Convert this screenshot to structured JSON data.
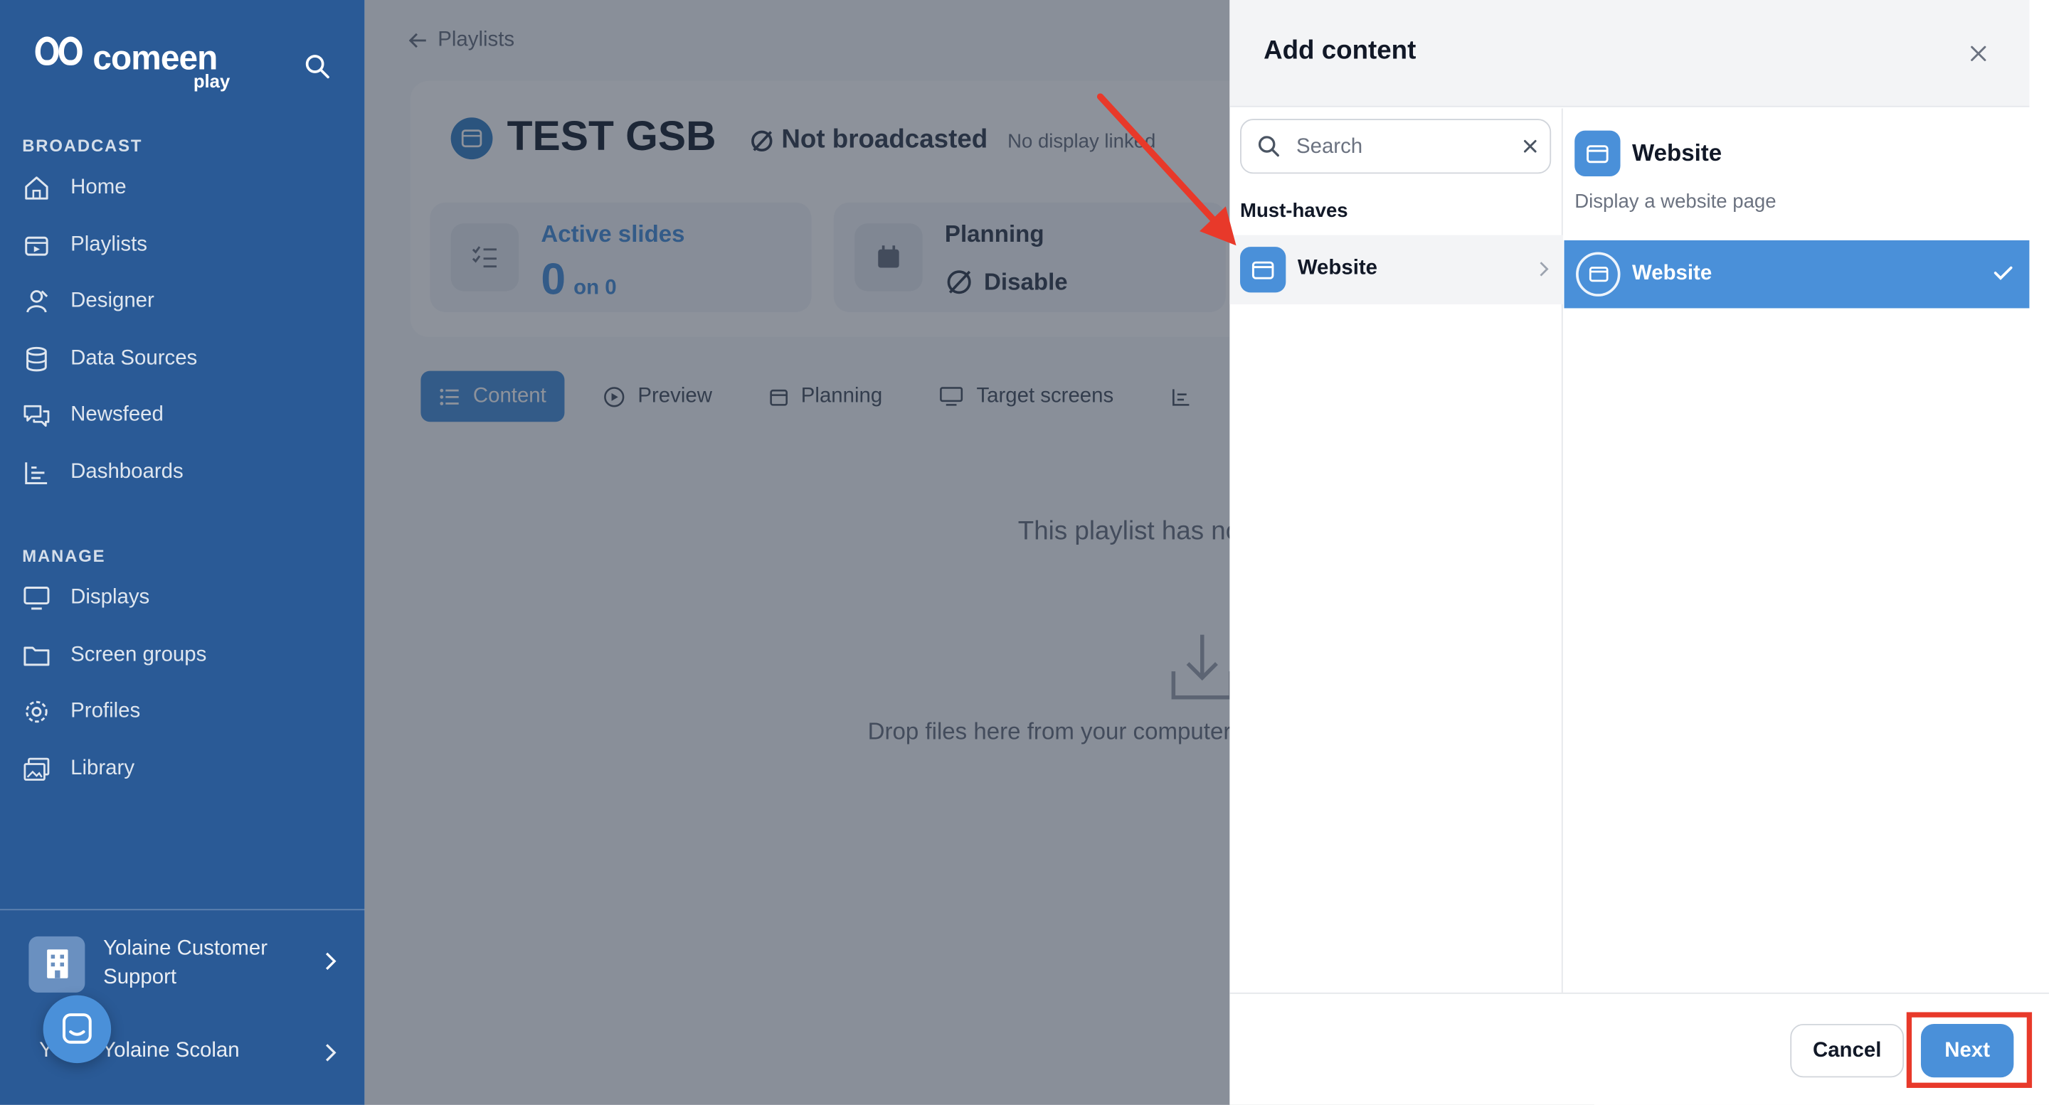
{
  "sidebar": {
    "logo_text": "comeen",
    "logo_sub": "play",
    "broadcast_label": "BROADCAST",
    "broadcast_items": [
      {
        "label": "Home",
        "icon": "home-icon"
      },
      {
        "label": "Playlists",
        "icon": "playlists-icon"
      },
      {
        "label": "Designer",
        "icon": "designer-icon"
      },
      {
        "label": "Data Sources",
        "icon": "database-icon"
      },
      {
        "label": "Newsfeed",
        "icon": "chat-icon"
      },
      {
        "label": "Dashboards",
        "icon": "chart-icon"
      }
    ],
    "manage_label": "MANAGE",
    "manage_items": [
      {
        "label": "Displays",
        "icon": "monitor-icon"
      },
      {
        "label": "Screen groups",
        "icon": "folder-icon"
      },
      {
        "label": "Profiles",
        "icon": "gear-icon"
      },
      {
        "label": "Library",
        "icon": "images-icon"
      }
    ],
    "org_name": "Yolaine Customer Support",
    "user_initial": "Y",
    "user_name": "Yolaine Scolan"
  },
  "main": {
    "back_label": "Playlists",
    "playlist_title": "TEST GSB",
    "status": "Not broadcasted",
    "display_info": "No display linked",
    "stat_active_label": "Active slides",
    "stat_active_value": "0",
    "stat_active_total": "on 0",
    "stat_planning_label": "Planning",
    "stat_planning_value": "Disable",
    "tabs": [
      {
        "label": "Content",
        "icon": "list-icon"
      },
      {
        "label": "Preview",
        "icon": "play-icon"
      },
      {
        "label": "Planning",
        "icon": "calendar-icon"
      },
      {
        "label": "Target screens",
        "icon": "monitor-icon"
      }
    ],
    "empty_text": "This playlist has no content",
    "drop_text": "Drop files here from your computer"
  },
  "modal": {
    "title": "Add content",
    "search_placeholder": "Search",
    "group_label": "Must-haves",
    "category_label": "Website",
    "detail_title": "Website",
    "detail_description": "Display a website page",
    "option_label": "Website",
    "cancel_label": "Cancel",
    "next_label": "Next"
  },
  "colors": {
    "sidebar_bg": "#2a5a96",
    "accent": "#4a90d9",
    "highlight": "#e8392a"
  }
}
